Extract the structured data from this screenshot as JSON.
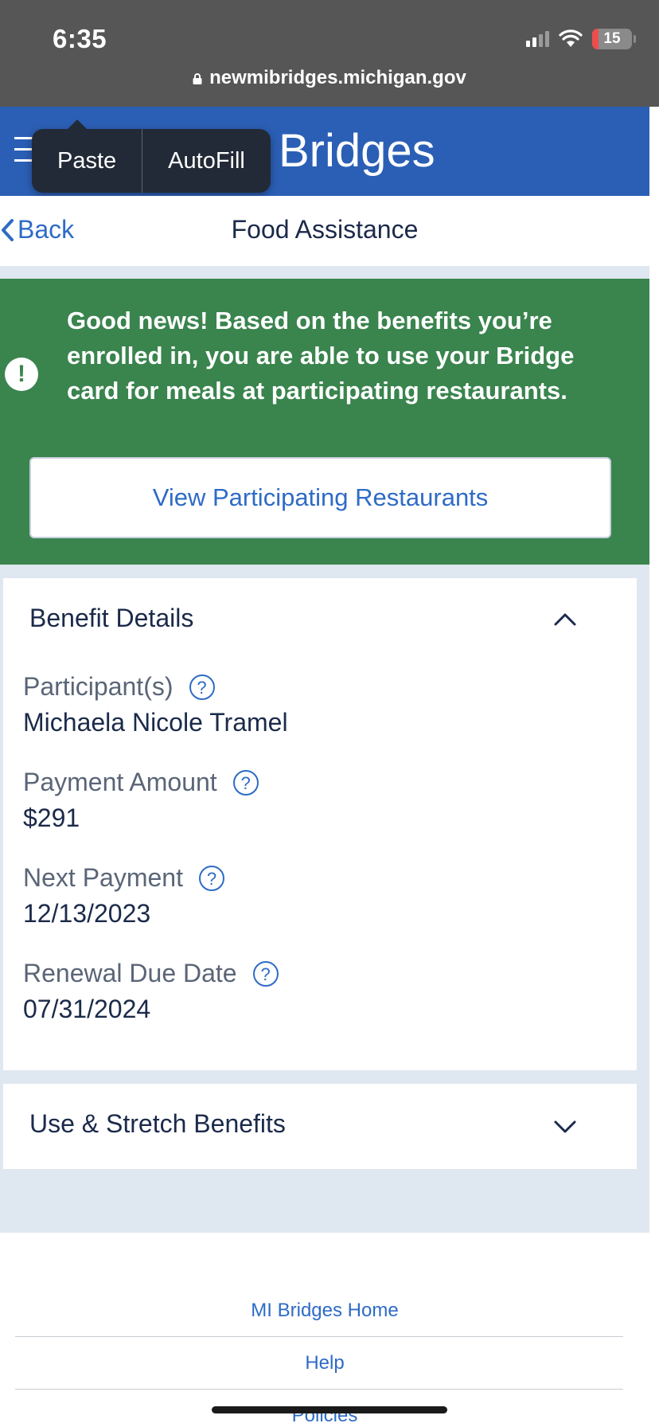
{
  "status_bar": {
    "time": "6:35",
    "battery_level": "15",
    "battery_fraction": 0.15,
    "icons": [
      "signal-icon",
      "wifi-icon",
      "battery-icon"
    ]
  },
  "browser": {
    "url": "newmibridges.michigan.gov",
    "lock_icon": "lock-icon"
  },
  "edit_menu": {
    "paste_label": "Paste",
    "autofill_label": "AutoFill"
  },
  "header": {
    "title_visible": "Bridges",
    "menu_icon": "hamburger-menu-icon",
    "color": "#2b5fb5"
  },
  "subheader": {
    "back_label": "Back",
    "page_title": "Food Assistance"
  },
  "banner": {
    "message": "Good news! Based on the benefits you’re enrolled in, you are able to use your Bridge card for meals at participating restaurants.",
    "button_label": "View Participating Restaurants",
    "icon": "exclamation-icon",
    "color": "#3a844e"
  },
  "benefit_details": {
    "title": "Benefit Details",
    "expanded": true,
    "fields": [
      {
        "label": "Participant(s)",
        "value": "Michaela Nicole Tramel"
      },
      {
        "label": "Payment Amount",
        "value": "$291"
      },
      {
        "label": "Next Payment",
        "value": "12/13/2023"
      },
      {
        "label": "Renewal Due Date",
        "value": "07/31/2024"
      }
    ]
  },
  "stretch_benefits": {
    "title": "Use & Stretch Benefits",
    "expanded": false
  },
  "footer": {
    "links": [
      "MI Bridges Home",
      "Help",
      "Policies"
    ]
  },
  "colors": {
    "link": "#2e6bc6",
    "text": "#1b2a4a",
    "page_bg": "#dfe7f0"
  }
}
